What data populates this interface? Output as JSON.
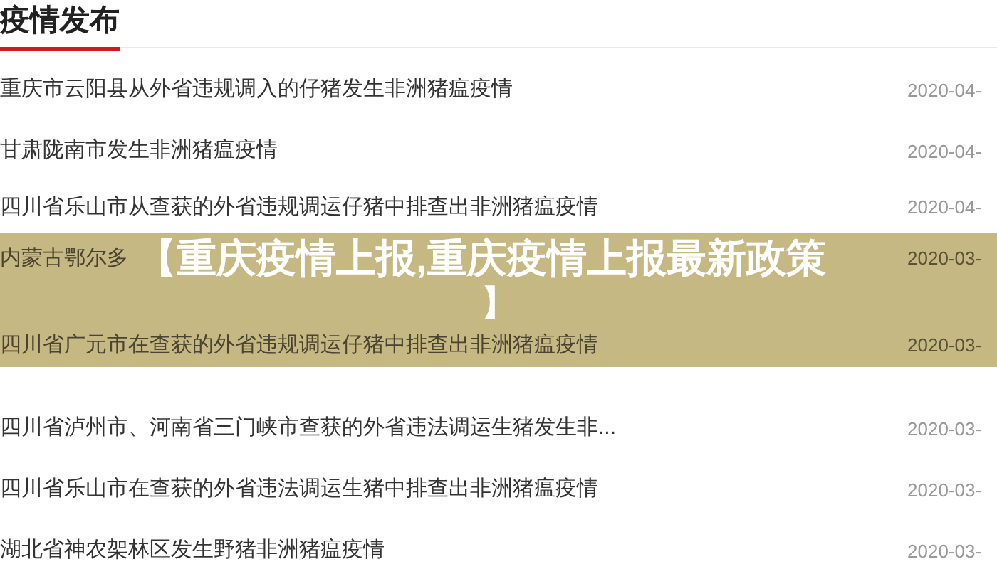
{
  "section": {
    "title": "疫情发布"
  },
  "news": [
    {
      "title": "重庆市云阳县从外省违规调入的仔猪发生非洲猪瘟疫情",
      "date": "2020-04-"
    },
    {
      "title": "甘肃陇南市发生非洲猪瘟疫情",
      "date": "2020-04-"
    },
    {
      "title": "四川省乐山市从查获的外省违规调运仔猪中排查出非洲猪瘟疫情",
      "date": "2020-04-"
    },
    {
      "title": "内蒙古鄂尔多",
      "date": "2020-03-"
    },
    {
      "title": "四川省广元市在查获的外省违规调运仔猪中排查出非洲猪瘟疫情",
      "date": "2020-03-"
    },
    {
      "title": "四川省泸州市、河南省三门峡市查获的外省违法调运生猪发生非...",
      "date": "2020-03-"
    },
    {
      "title": "四川省乐山市在查获的外省违法调运生猪中排查出非洲猪瘟疫情",
      "date": "2020-03-"
    },
    {
      "title": "湖北省神农架林区发生野猪非洲猪瘟疫情",
      "date": "2020-03-"
    }
  ],
  "banner": {
    "lines": [
      "【重庆疫情上报,重庆疫情上报最新政策",
      "】"
    ]
  }
}
